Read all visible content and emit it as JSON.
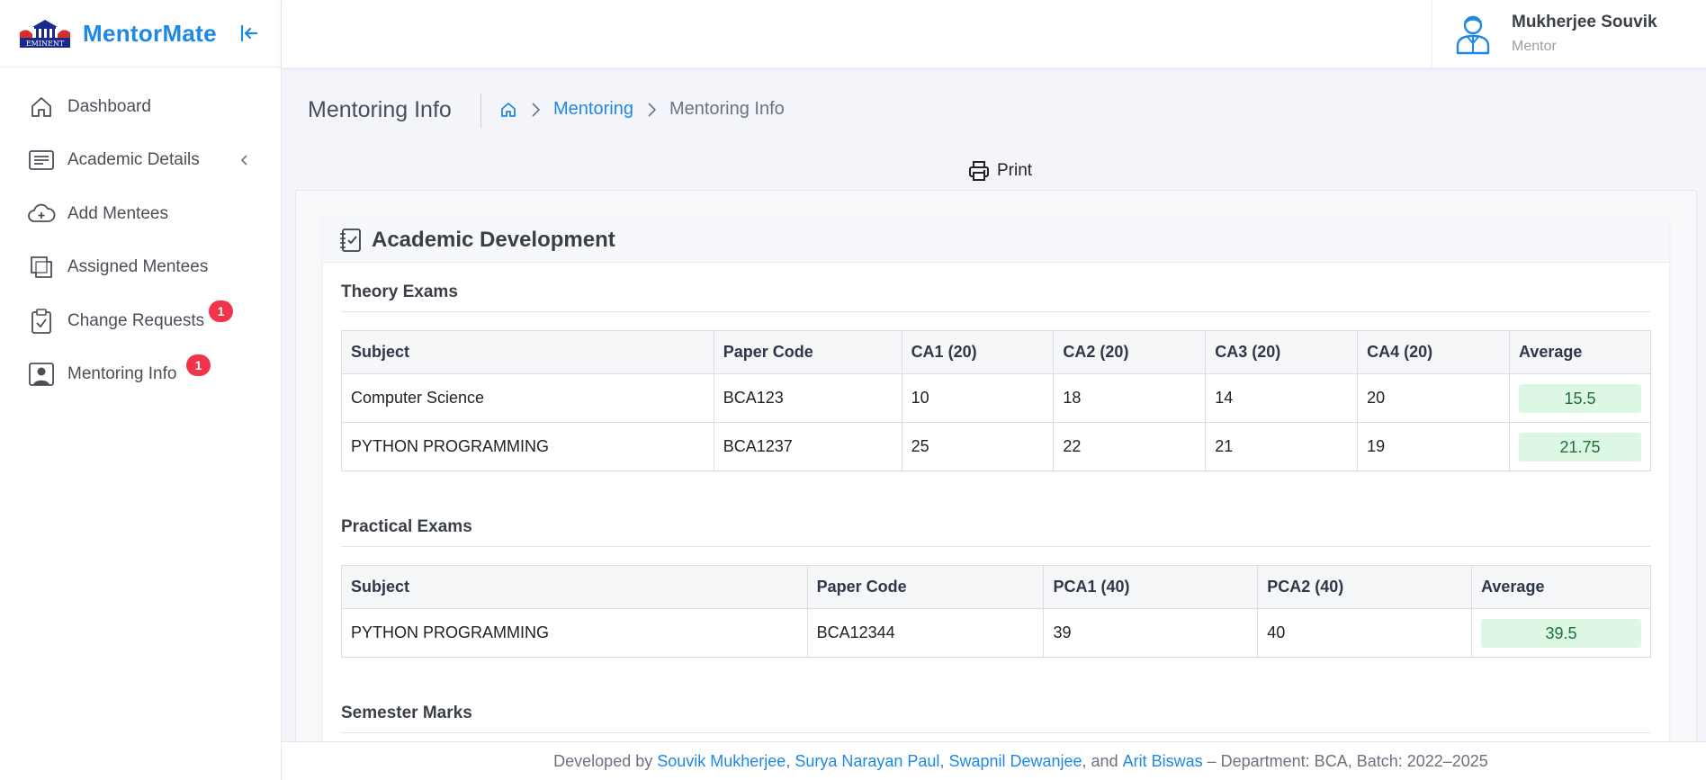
{
  "app": {
    "name": "MentorMate",
    "logo_text": "EMINENT"
  },
  "sidebar": {
    "items": [
      {
        "label": "Dashboard"
      },
      {
        "label": "Academic Details"
      },
      {
        "label": "Add Mentees"
      },
      {
        "label": "Assigned Mentees"
      },
      {
        "label": "Change Requests",
        "badge": "1"
      },
      {
        "label": "Mentoring Info",
        "badge": "1"
      }
    ]
  },
  "user": {
    "name": "Mukherjee Souvik",
    "role": "Mentor"
  },
  "page": {
    "title": "Mentoring Info",
    "breadcrumb": {
      "link": "Mentoring",
      "current": "Mentoring Info"
    },
    "print_label": "Print"
  },
  "card": {
    "title": "Academic Development"
  },
  "theory": {
    "title": "Theory Exams",
    "headers": [
      "Subject",
      "Paper Code",
      "CA1 (20)",
      "CA2 (20)",
      "CA3 (20)",
      "CA4 (20)",
      "Average"
    ],
    "rows": [
      [
        "Computer Science",
        "BCA123",
        "10",
        "18",
        "14",
        "20",
        "15.5"
      ],
      [
        "PYTHON PROGRAMMING",
        "BCA1237",
        "25",
        "22",
        "21",
        "19",
        "21.75"
      ]
    ]
  },
  "practical": {
    "title": "Practical Exams",
    "headers": [
      "Subject",
      "Paper Code",
      "PCA1 (40)",
      "PCA2 (40)",
      "Average"
    ],
    "rows": [
      [
        "PYTHON PROGRAMMING",
        "BCA12344",
        "39",
        "40",
        "39.5"
      ]
    ]
  },
  "semester": {
    "title": "Semester Marks"
  },
  "footer": {
    "prefix": "Developed by",
    "authors": [
      "Souvik Mukherjee",
      "Surya Narayan Paul",
      "Swapnil Dewanjee",
      "Arit Biswas"
    ],
    "suffix": "– Department: BCA, Batch: 2022–2025"
  },
  "colors": {
    "accent": "#1e88e5",
    "badge": "#f1344c",
    "avg_bg": "#dcf7e3"
  }
}
